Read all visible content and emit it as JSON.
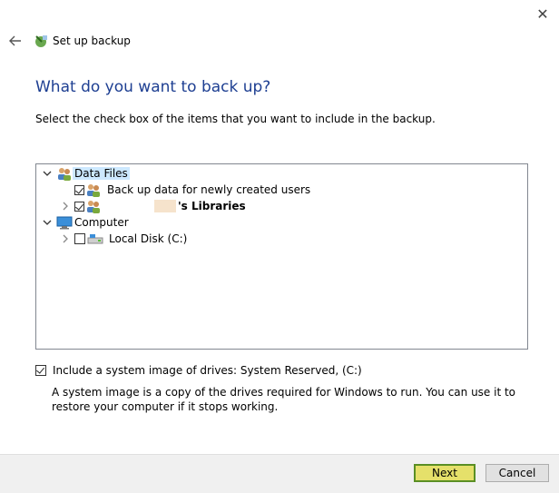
{
  "window": {
    "title": "Set up backup",
    "close_glyph": "✕"
  },
  "heading": "What do you want to back up?",
  "instructions": "Select the check box of the items that you want to include in the backup.",
  "tree": {
    "data_files": {
      "label": "Data Files",
      "icon": "users-icon"
    },
    "new_users": {
      "label": "Back up data for newly created users",
      "checked": true
    },
    "libraries": {
      "label": "'s Libraries",
      "checked": true
    },
    "computer": {
      "label": "Computer",
      "icon": "monitor-icon"
    },
    "local_disk": {
      "label": "Local Disk (C:)",
      "checked": false
    }
  },
  "system_image": {
    "label": "Include a system image of drives: System Reserved, (C:)",
    "checked": true,
    "description": "A system image is a copy of the drives required for Windows to run. You can use it to restore your computer if it stops working."
  },
  "buttons": {
    "next": "Next",
    "cancel": "Cancel"
  },
  "colors": {
    "heading": "#1e3f92",
    "selection": "#cce8ff",
    "next_button": "#e5e06a",
    "footer": "#f0f0f0"
  }
}
